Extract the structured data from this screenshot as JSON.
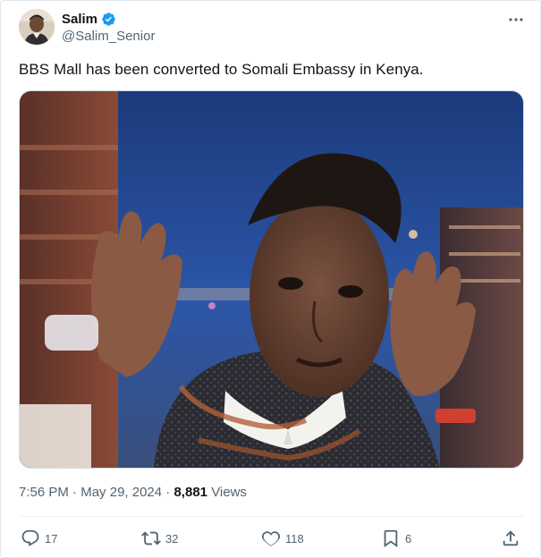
{
  "author": {
    "display_name": "Salim",
    "handle": "@Salim_Senior",
    "verified": true
  },
  "tweet": {
    "text": "BBS Mall has been converted to Somali Embassy in Kenya."
  },
  "meta": {
    "time": "7:56 PM",
    "separator": "·",
    "date": "May 29, 2024",
    "views_count": "8,881",
    "views_label": "Views"
  },
  "actions": {
    "replies": "17",
    "reposts": "32",
    "likes": "118",
    "bookmarks": "6"
  },
  "icons": {
    "verified": "verified-badge-icon",
    "more": "more-horizontal-icon",
    "reply": "reply-icon",
    "repost": "repost-icon",
    "like": "heart-icon",
    "bookmark": "bookmark-icon",
    "share": "share-icon"
  },
  "colors": {
    "text_primary": "#0f1419",
    "text_secondary": "#536471",
    "verified_blue": "#1d9bf0",
    "divider": "#eff3f4"
  }
}
